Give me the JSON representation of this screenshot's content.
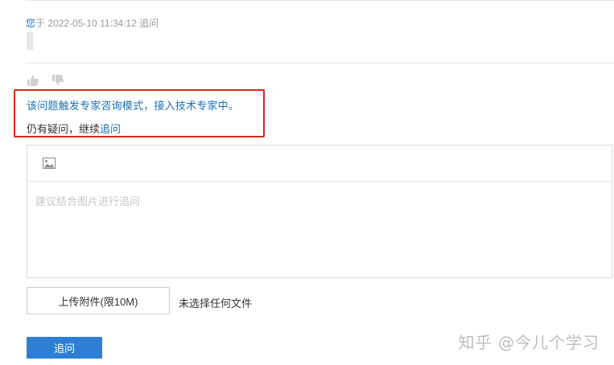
{
  "meta": {
    "user": "您",
    "suffix": "于 2022-05-10 11:34:12 追问"
  },
  "icons": {
    "vote_up": "thumbs-up-icon",
    "vote_down": "thumbs-down-icon",
    "image": "image-icon"
  },
  "notice": {
    "text": "该问题触发专家咨询模式，接入技术专家中。"
  },
  "followup": {
    "prefix": "仍有疑问，继续",
    "link": "追问"
  },
  "editor": {
    "placeholder": "建议结合图片进行追问"
  },
  "upload": {
    "button_label": "上传附件(限10M)",
    "status": "未选择任何文件"
  },
  "submit": {
    "label": "追问"
  },
  "watermark": {
    "text": "知乎 @今儿个学习"
  },
  "colors": {
    "link": "#1a6fb6",
    "highlight_border": "#d9261c",
    "primary_button": "#2d7fd3"
  }
}
